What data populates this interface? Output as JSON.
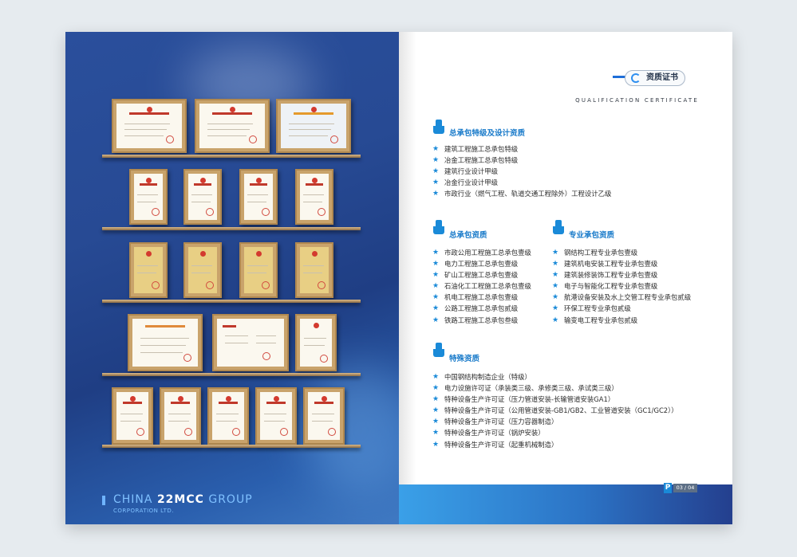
{
  "left": {
    "logo_main_a": "CHINA",
    "logo_main_b": "22MCC",
    "logo_main_c": "GROUP",
    "logo_sub": "CORPORATION LTD."
  },
  "right": {
    "badge": "资质证书",
    "en_sub": "QUALIFICATION CERTIFICATE",
    "page_number": "03 / 04",
    "page_icon": "P",
    "sections": {
      "general": {
        "title": "总承包特级及设计资质",
        "items": [
          "建筑工程施工总承包特级",
          "冶金工程施工总承包特级",
          "建筑行业设计甲级",
          "冶金行业设计甲级",
          "市政行业（燃气工程、轨道交通工程除外）工程设计乙级"
        ]
      },
      "contract": {
        "title": "总承包资质",
        "items": [
          "市政公用工程施工总承包壹级",
          "电力工程施工总承包壹级",
          "矿山工程施工总承包壹级",
          "石油化工工程施工总承包壹级",
          "机电工程施工总承包壹级",
          "公路工程施工总承包贰级",
          "铁路工程施工总承包叁级"
        ]
      },
      "specialty": {
        "title": "专业承包资质",
        "items": [
          "钢结构工程专业承包壹级",
          "建筑机电安装工程专业承包壹级",
          "建筑装修装饰工程专业承包壹级",
          "电子与智能化工程专业承包壹级",
          "航港设备安装及水上交管工程专业承包贰级",
          "环保工程专业承包贰级",
          "输变电工程专业承包贰级"
        ]
      },
      "special": {
        "title": "特殊资质",
        "items": [
          "中国钢结构制造企业（特级）",
          "电力设施许可证（承装类三级、承修类三级、承试类三级）",
          "特种设备生产许可证（压力管道安装-长输管道安装GA1）",
          "特种设备生产许可证（公用管道安装-GB1/GB2、工业管道安装（GC1/GC2））",
          "特种设备生产许可证（压力容器制造）",
          "特种设备生产许可证（锅炉安装）",
          "特种设备生产许可证（起重机械制造）"
        ]
      }
    }
  },
  "colors": {
    "accent": "#1a8ad8",
    "left_page": "#274a94",
    "shelf": "#b08850",
    "section_title": "#1779c9"
  },
  "icons": [
    "star-bullet-icon",
    "trophy-icon",
    "qualification-ring-icon"
  ]
}
